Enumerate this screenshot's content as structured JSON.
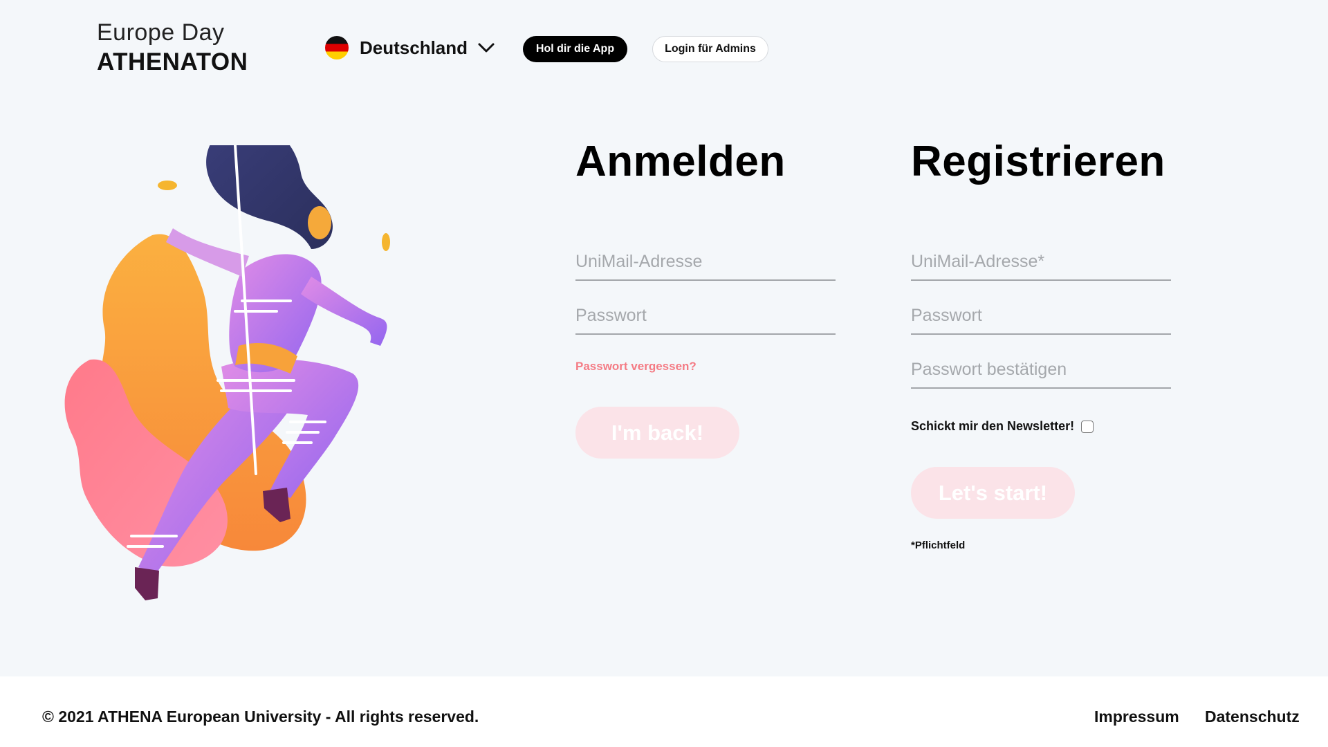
{
  "header": {
    "brand_line1": "Europe Day",
    "brand_line2": "ATHENATON",
    "country": {
      "label": "Deutschland",
      "flag_icon": "germany-flag-icon",
      "chevron_icon": "chevron-down-icon"
    },
    "app_button": "Hol dir die App",
    "admin_button": "Login für Admins"
  },
  "login": {
    "title": "Anmelden",
    "email_placeholder": "UniMail-Adresse",
    "password_placeholder": "Passwort",
    "forgot_link": "Passwort vergessen?",
    "submit": "I'm back!"
  },
  "register": {
    "title": "Registrieren",
    "email_placeholder": "UniMail-Adresse*",
    "password_placeholder": "Passwort",
    "confirm_placeholder": "Passwort bestätigen",
    "newsletter_label": "Schickt mir den Newsletter!",
    "submit": "Let's start!",
    "required_note": "*Pflichtfeld"
  },
  "footer": {
    "copyright": "© 2021 ATHENA European University - All rights reserved.",
    "links": [
      "Impressum",
      "Datenschutz"
    ]
  },
  "colors": {
    "background": "#f4f7fa",
    "accent_pink": "#f47b84",
    "button_disabled": "#fbe3e8",
    "primary_dark": "#000000"
  }
}
